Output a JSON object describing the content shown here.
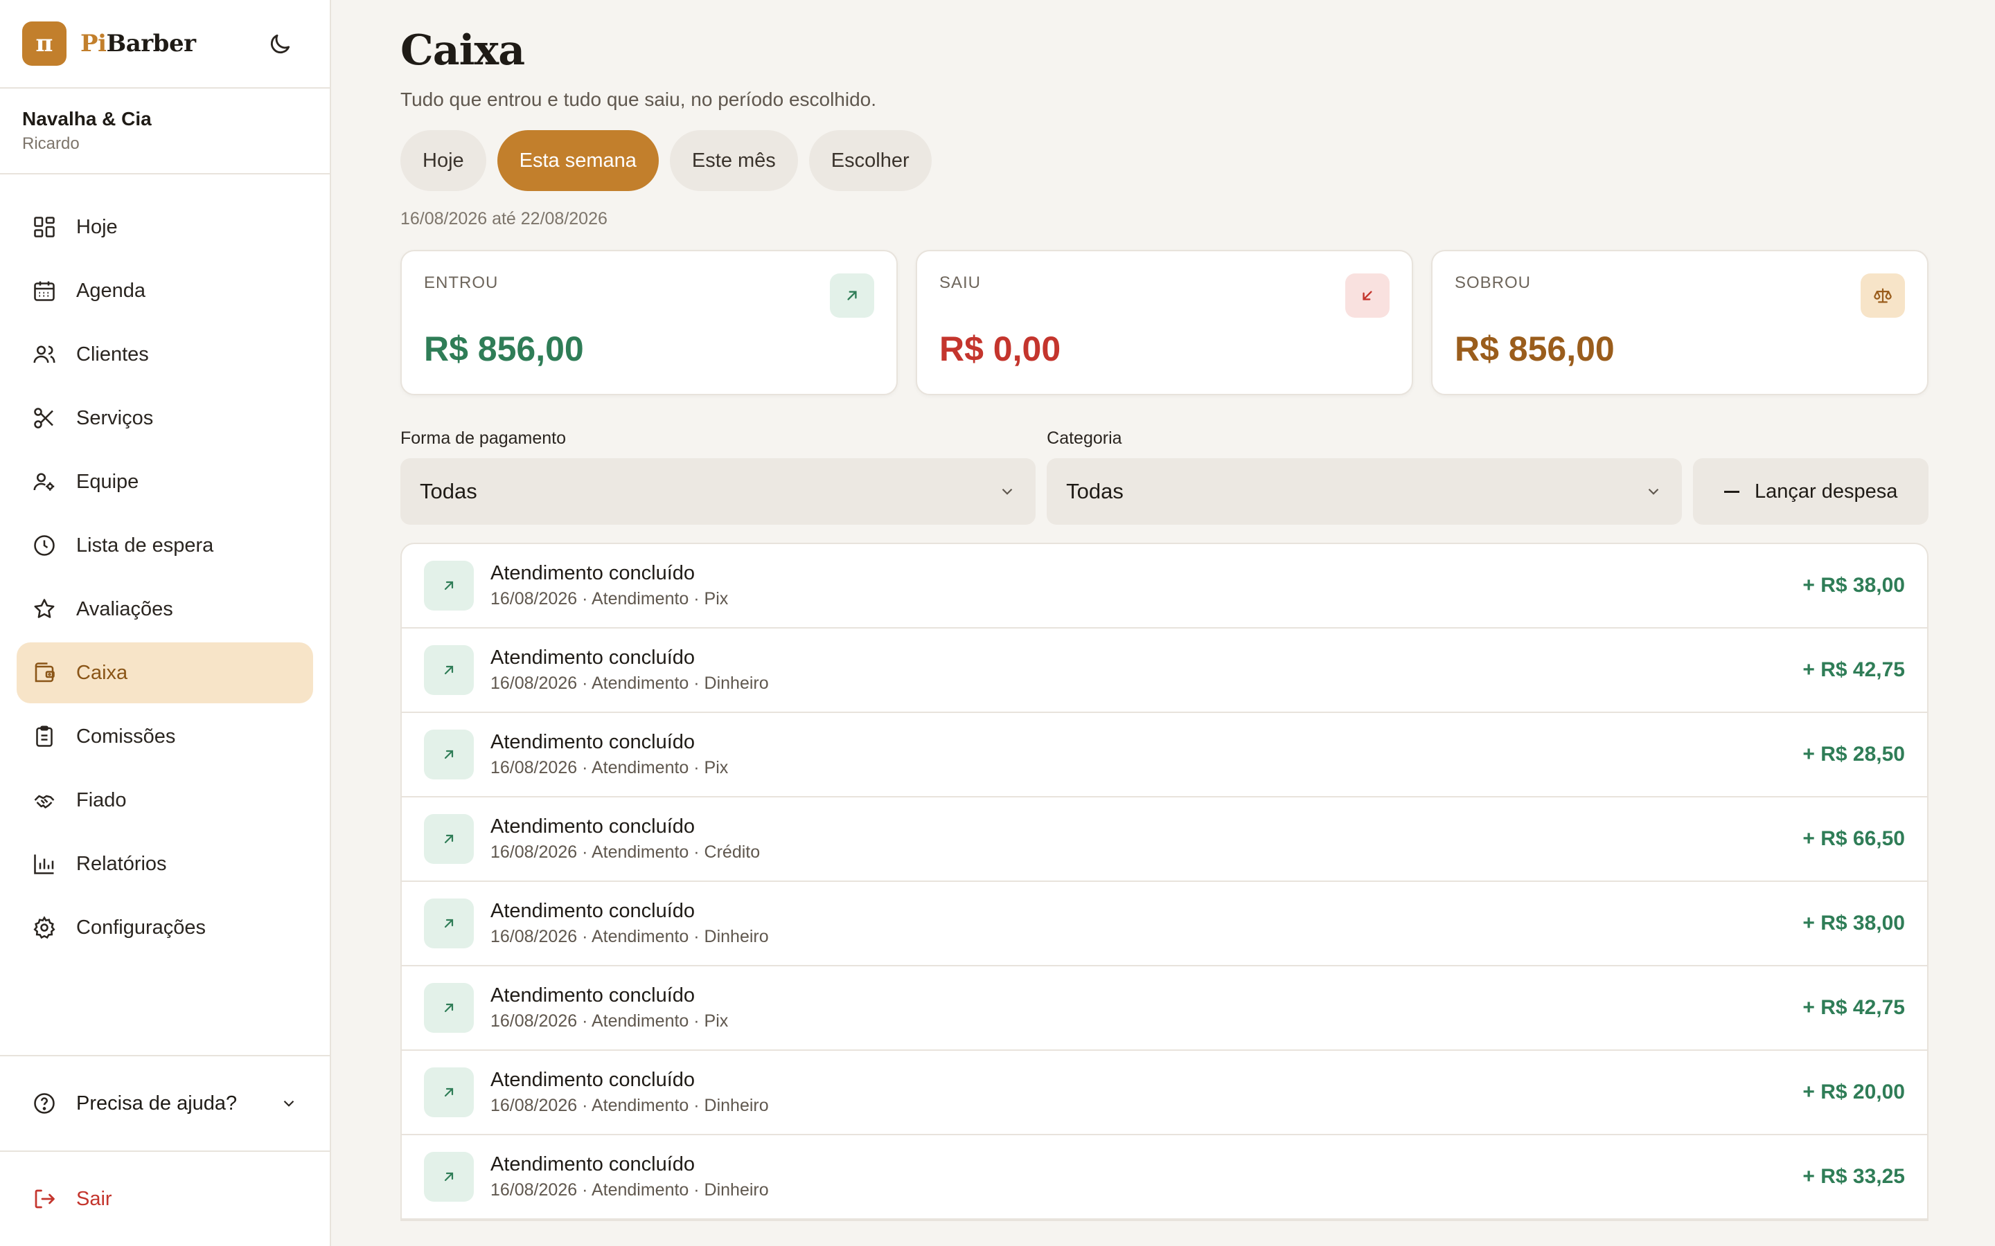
{
  "brand": {
    "logo_glyph": "π",
    "name_prefix": "Pi",
    "name_suffix": "Barber",
    "theme_toggle_icon": "moon-icon"
  },
  "shop": {
    "name": "Navalha & Cia",
    "user": "Ricardo"
  },
  "sidebar": {
    "items": [
      {
        "label": "Hoje",
        "icon": "dashboard-icon"
      },
      {
        "label": "Agenda",
        "icon": "calendar-icon"
      },
      {
        "label": "Clientes",
        "icon": "users-icon"
      },
      {
        "label": "Serviços",
        "icon": "scissors-icon"
      },
      {
        "label": "Equipe",
        "icon": "team-icon"
      },
      {
        "label": "Lista de espera",
        "icon": "clock-icon"
      },
      {
        "label": "Avaliações",
        "icon": "star-icon"
      },
      {
        "label": "Caixa",
        "icon": "wallet-icon",
        "active": true
      },
      {
        "label": "Comissões",
        "icon": "clipboard-icon"
      },
      {
        "label": "Fiado",
        "icon": "handshake-icon"
      },
      {
        "label": "Relatórios",
        "icon": "bar-chart-icon"
      },
      {
        "label": "Configurações",
        "icon": "gear-icon"
      }
    ],
    "help_label": "Precisa de ajuda?",
    "logout_label": "Sair"
  },
  "main": {
    "title": "Caixa",
    "subtitle": "Tudo que entrou e tudo que saiu, no período escolhido.",
    "tabs": [
      {
        "label": "Hoje"
      },
      {
        "label": "Esta semana",
        "active": true
      },
      {
        "label": "Este mês"
      },
      {
        "label": "Escolher"
      }
    ],
    "range": "16/08/2026 até 22/08/2026",
    "cards": [
      {
        "label": "ENTROU",
        "value": "R$ 856,00",
        "icon": "arrow-up-right-icon",
        "color": "#2f7d57"
      },
      {
        "label": "SAIU",
        "value": "R$ 0,00",
        "icon": "arrow-down-left-icon",
        "color": "#c4352d"
      },
      {
        "label": "SOBROU",
        "value": "R$ 856,00",
        "icon": "scale-icon",
        "color": "#9a5d1c"
      }
    ],
    "filters": {
      "payment_label": "Forma de pagamento",
      "payment_value": "Todas",
      "category_label": "Categoria",
      "category_value": "Todas",
      "expense_button": "Lançar despesa"
    },
    "transactions": [
      {
        "title": "Atendimento concluído",
        "meta": "16/08/2026 · Atendimento · Pix",
        "amount": "+ R$ 38,00"
      },
      {
        "title": "Atendimento concluído",
        "meta": "16/08/2026 · Atendimento · Dinheiro",
        "amount": "+ R$ 42,75"
      },
      {
        "title": "Atendimento concluído",
        "meta": "16/08/2026 · Atendimento · Pix",
        "amount": "+ R$ 28,50"
      },
      {
        "title": "Atendimento concluído",
        "meta": "16/08/2026 · Atendimento · Crédito",
        "amount": "+ R$ 66,50"
      },
      {
        "title": "Atendimento concluído",
        "meta": "16/08/2026 · Atendimento · Dinheiro",
        "amount": "+ R$ 38,00"
      },
      {
        "title": "Atendimento concluído",
        "meta": "16/08/2026 · Atendimento · Pix",
        "amount": "+ R$ 42,75"
      },
      {
        "title": "Atendimento concluído",
        "meta": "16/08/2026 · Atendimento · Dinheiro",
        "amount": "+ R$ 20,00"
      },
      {
        "title": "Atendimento concluído",
        "meta": "16/08/2026 · Atendimento · Dinheiro",
        "amount": "+ R$ 33,25"
      }
    ]
  },
  "colors": {
    "accent": "#c27f2c",
    "active_bg": "#f7e4c8",
    "income": "#2f7d57",
    "expense": "#c4352d",
    "balance": "#9a5d1c"
  }
}
